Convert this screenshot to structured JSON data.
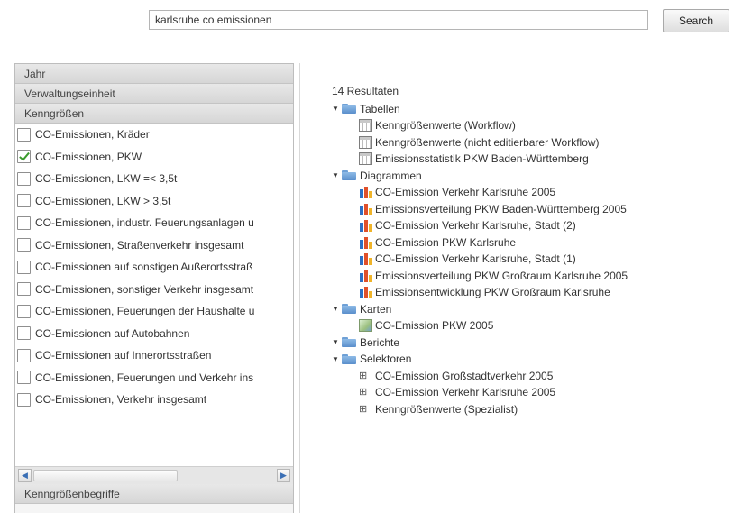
{
  "search": {
    "value": "karlsruhe co emissionen",
    "button_label": "Search"
  },
  "left_panel": {
    "sections": [
      "Jahr",
      "Verwaltungseinheit",
      "Kenngrößen"
    ],
    "items": [
      {
        "label": "CO-Emissionen, Kräder",
        "checked": false
      },
      {
        "label": "CO-Emissionen, PKW",
        "checked": true
      },
      {
        "label": "CO-Emissionen, LKW =< 3,5t",
        "checked": false
      },
      {
        "label": "CO-Emissionen, LKW > 3,5t",
        "checked": false
      },
      {
        "label": "CO-Emissionen, industr. Feuerungsanlagen u",
        "checked": false
      },
      {
        "label": "CO-Emissionen, Straßenverkehr insgesamt",
        "checked": false
      },
      {
        "label": "CO-Emissionen auf sonstigen Außerortsstraß",
        "checked": false
      },
      {
        "label": "CO-Emissionen, sonstiger Verkehr insgesamt",
        "checked": false
      },
      {
        "label": "CO-Emissionen, Feuerungen der Haushalte u",
        "checked": false
      },
      {
        "label": "CO-Emissionen auf Autobahnen",
        "checked": false
      },
      {
        "label": "CO-Emissionen auf Innerortsstraßen",
        "checked": false
      },
      {
        "label": "CO-Emissionen, Feuerungen und Verkehr ins",
        "checked": false
      },
      {
        "label": "CO-Emissionen, Verkehr insgesamt",
        "checked": false
      }
    ],
    "bottom_section": "Kenngrößenbegriffe"
  },
  "results": {
    "count_label": "14 Resultaten",
    "groups": [
      {
        "label": "Tabellen",
        "icon": "table-icon",
        "items": [
          "Kenngrößenwerte (Workflow)",
          "Kenngrößenwerte (nicht editierbarer Workflow)",
          "Emissionsstatistik PKW Baden-Württemberg"
        ]
      },
      {
        "label": "Diagrammen",
        "icon": "chart-icon",
        "items": [
          "CO-Emission Verkehr Karlsruhe 2005",
          "Emissionsverteilung PKW Baden-Württemberg 2005",
          "CO-Emission Verkehr Karlsruhe, Stadt (2)",
          "CO-Emission PKW Karlsruhe",
          "CO-Emission Verkehr Karlsruhe, Stadt (1)",
          "Emissionsverteilung PKW Großraum Karlsruhe 2005",
          "Emissionsentwicklung PKW Großraum Karlsruhe"
        ]
      },
      {
        "label": "Karten",
        "icon": "map-icon",
        "items": [
          "CO-Emission PKW 2005"
        ]
      },
      {
        "label": "Berichte",
        "icon": "report-icon",
        "items": []
      },
      {
        "label": "Selektoren",
        "icon": "selector-icon",
        "items": [
          "CO-Emission Großstadtverkehr 2005",
          "CO-Emission Verkehr Karlsruhe 2005",
          "Kenngrößenwerte (Spezialist)"
        ]
      }
    ]
  }
}
